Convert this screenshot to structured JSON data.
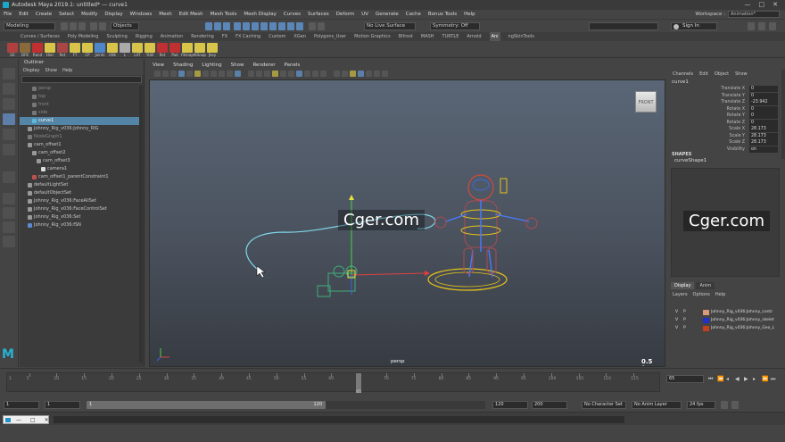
{
  "window": {
    "title": "Autodesk Maya 2019.1: untitled*   ---   curve1",
    "controls": [
      "—",
      "□",
      "✕"
    ]
  },
  "menubar": {
    "items": [
      "File",
      "Edit",
      "Create",
      "Select",
      "Modify",
      "Display",
      "Windows",
      "Mesh",
      "Edit Mesh",
      "Mesh Tools",
      "Mesh Display",
      "Curves",
      "Surfaces",
      "Deform",
      "UV",
      "Generate",
      "Cache",
      "Bonus Tools",
      "Help"
    ],
    "workspace_label": "Workspace :",
    "workspace_value": "Animation*"
  },
  "statusline": {
    "mode": "Modeling",
    "objects_label": "Objects",
    "live_surface": "No Live Surface",
    "symmetry": "Symmetry: Off",
    "sign_in": "Sign In"
  },
  "shelf": {
    "tabs": [
      "Curves / Surfaces",
      "Poly Modeling",
      "Sculpting",
      "Rigging",
      "Animation",
      "Rendering",
      "FX",
      "FX Caching",
      "Custom",
      "XGen",
      "Polygons_User",
      "Motion Graphics",
      "Bifrost",
      "MASH",
      "TURTLE",
      "Arnold",
      "Ani",
      "ngSkinTools"
    ],
    "active_tab": "Ani",
    "icons": [
      {
        "label": "GE",
        "color": "#b04040"
      },
      {
        "label": "DFK",
        "color": "#8a6a3a"
      },
      {
        "label": "Rand",
        "color": "#c03030"
      },
      {
        "label": "Hier",
        "color": "#d9c44a"
      },
      {
        "label": "Ret",
        "color": "#a94545"
      },
      {
        "label": "FT",
        "color": "#d9c44a"
      },
      {
        "label": "CP",
        "color": "#d9c44a"
      },
      {
        "label": "Joints",
        "color": "#4d87c9"
      },
      {
        "label": "USK",
        "color": "#d9c44a"
      },
      {
        "label": "L",
        "color": "#aaaaaa"
      },
      {
        "label": "LAT",
        "color": "#d9c44a"
      },
      {
        "label": "YLW",
        "color": "#d9c44a"
      },
      {
        "label": "Ret",
        "color": "#c03030"
      },
      {
        "label": "Pad",
        "color": "#c03030"
      },
      {
        "label": "FKmap",
        "color": "#d9c44a"
      },
      {
        "label": "IKSnap",
        "color": "#d9c44a"
      },
      {
        "label": "Jkey",
        "color": "#d9c44a"
      }
    ]
  },
  "outliner": {
    "title": "Outliner",
    "menu": [
      "Display",
      "Show",
      "Help"
    ],
    "rows": [
      {
        "label": "persp",
        "indent": 2,
        "state": "dim",
        "icon": "#777777"
      },
      {
        "label": "top",
        "indent": 2,
        "state": "dim",
        "icon": "#777777"
      },
      {
        "label": "front",
        "indent": 2,
        "state": "dim",
        "icon": "#777777"
      },
      {
        "label": "side",
        "indent": 2,
        "state": "dim",
        "icon": "#777777"
      },
      {
        "label": "curve1",
        "indent": 2,
        "state": "sel",
        "icon": "#5fb8d8"
      },
      {
        "label": "Johnny_Rig_v036:Johnny_RIG",
        "indent": 1,
        "state": "",
        "icon": "#999999"
      },
      {
        "label": "NodeGraph1",
        "indent": 1,
        "state": "dim",
        "icon": "#777777"
      },
      {
        "label": "cam_offset1",
        "indent": 1,
        "state": "",
        "icon": "#999999"
      },
      {
        "label": "cam_offset2",
        "indent": 2,
        "state": "",
        "icon": "#999999"
      },
      {
        "label": "cam_offset3",
        "indent": 3,
        "state": "",
        "icon": "#999999"
      },
      {
        "label": "camera1",
        "indent": 4,
        "state": "",
        "icon": "#dddddd"
      },
      {
        "label": "cam_offset1_parentConstraint1",
        "indent": 2,
        "state": "",
        "icon": "#c05050"
      },
      {
        "label": "defaultLightSet",
        "indent": 1,
        "state": "",
        "icon": "#999999"
      },
      {
        "label": "defaultObjectSet",
        "indent": 1,
        "state": "",
        "icon": "#999999"
      },
      {
        "label": "Johnny_Rig_v036:FaceAllSet",
        "indent": 1,
        "state": "",
        "icon": "#999999"
      },
      {
        "label": "Johnny_Rig_v036:FaceControlSet",
        "indent": 1,
        "state": "",
        "icon": "#999999"
      },
      {
        "label": "Johnny_Rig_v036:Set",
        "indent": 1,
        "state": "",
        "icon": "#999999"
      },
      {
        "label": "Johnny_Rig_v036:fSN",
        "indent": 1,
        "state": "",
        "icon": "#5a8ad0"
      }
    ]
  },
  "viewport": {
    "menu": [
      "View",
      "Shading",
      "Lighting",
      "Show",
      "Renderer",
      "Panels"
    ],
    "viewcube": "FRONT",
    "camera": "persp",
    "fps": "0.5 fps"
  },
  "watermark": "Cger.com",
  "channelbox": {
    "menu": [
      "Channels",
      "Edit",
      "Object",
      "Show"
    ],
    "object": "curve1",
    "attributes": [
      {
        "name": "Translate X",
        "value": "0"
      },
      {
        "name": "Translate Y",
        "value": "0"
      },
      {
        "name": "Translate Z",
        "value": "-23.942"
      },
      {
        "name": "Rotate X",
        "value": "0"
      },
      {
        "name": "Rotate Y",
        "value": "0"
      },
      {
        "name": "Rotate Z",
        "value": "0"
      },
      {
        "name": "Scale X",
        "value": "28.173"
      },
      {
        "name": "Scale Y",
        "value": "28.173"
      },
      {
        "name": "Scale Z",
        "value": "28.173"
      },
      {
        "name": "Visibility",
        "value": "on"
      }
    ],
    "shapes_label": "SHAPES",
    "shape": "curveShape1"
  },
  "layers": {
    "tabs": [
      "Display",
      "Anim"
    ],
    "menu": [
      "Layers",
      "Options",
      "Help"
    ],
    "rows": [
      {
        "v": "V",
        "p": "P",
        "color": "#d89a7a",
        "name": "Johnny_Rig_v036:Johnny_contr"
      },
      {
        "v": "V",
        "p": "P",
        "color": "#2030c8",
        "name": "Johnny_Rig_v036:Johnny_skelet"
      },
      {
        "v": "V",
        "p": "P",
        "color": "#c04020",
        "name": "Johnny_Rig_v036:Johnny_Geo_L"
      }
    ]
  },
  "timeslider": {
    "ticks": [
      "5",
      "10",
      "15",
      "20",
      "25",
      "30",
      "35",
      "40",
      "45",
      "50",
      "55",
      "60",
      "65",
      "70",
      "75",
      "80",
      "85",
      "90",
      "95",
      "100",
      "105",
      "110",
      "115"
    ],
    "start_tick": "1",
    "current_frame": "65",
    "current_frame_field": "65"
  },
  "range": {
    "start": "1",
    "start2": "1",
    "slider_start": "1",
    "slider_end": "120",
    "end": "120",
    "end2": "200",
    "character_set": "No Character Set",
    "anim_layer": "No Anim Layer",
    "fps": "24 fps"
  },
  "cmdline": {
    "language": "MEL"
  }
}
